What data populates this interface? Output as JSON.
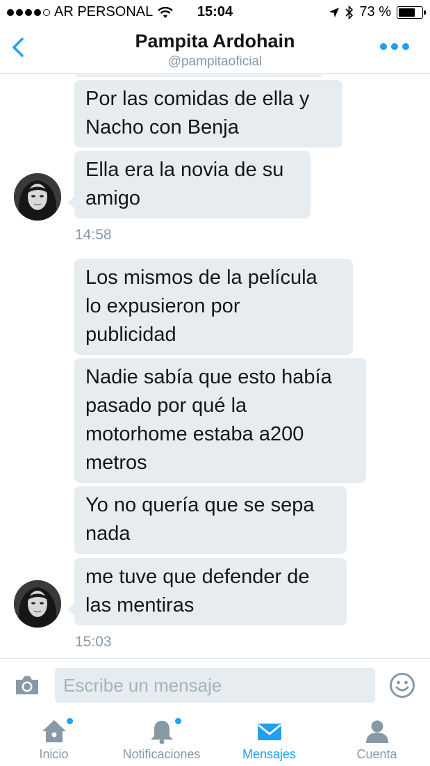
{
  "status_bar": {
    "carrier": "AR PERSONAL",
    "time": "15:04",
    "battery_text": "73 %",
    "battery_level": 0.73
  },
  "header": {
    "name": "Pampita Ardohain",
    "handle": "@pampitaoficial"
  },
  "messages": [
    {
      "text": "Por las comidas de ella y\nNacho con Benja"
    },
    {
      "text": "Ella era la novia de su\namigo"
    },
    {
      "text": "Los mismos de la película\nlo expusieron por\npublicidad"
    },
    {
      "text": "Nadie sabía que esto había\npasado por qué la\nmotorhome estaba a200\nmetros"
    },
    {
      "text": "Yo no quería que se sepa\nnada"
    },
    {
      "text": "me tuve que defender de\nlas mentiras"
    }
  ],
  "timestamps": [
    "14:58",
    "15:03"
  ],
  "composer": {
    "placeholder": "Escribe un mensaje"
  },
  "tabs": [
    {
      "label": "Inicio",
      "icon": "home-icon",
      "badge": true
    },
    {
      "label": "Notificaciones",
      "icon": "bell-icon",
      "badge": true
    },
    {
      "label": "Mensajes",
      "icon": "envelope-icon",
      "active": true
    },
    {
      "label": "Cuenta",
      "icon": "person-icon"
    }
  ],
  "colors": {
    "accent": "#1da1f2",
    "bubble": "#e6ecf0",
    "muted": "#8899a6"
  }
}
